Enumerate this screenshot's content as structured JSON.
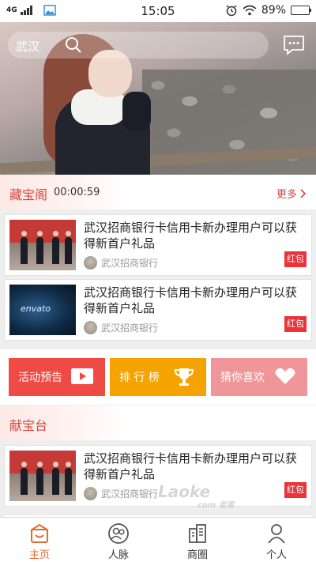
{
  "status_bar": {
    "network": "4G",
    "time": "15:05",
    "battery_percent": "89%",
    "battery_level": 0.89
  },
  "header": {
    "city": "武汉",
    "search_icon": "search-icon",
    "message_icon": "message-icon"
  },
  "treasure": {
    "title": "藏宝阁",
    "timer": "00:00:59",
    "more": "更多",
    "items": [
      {
        "title": "武汉招商银行卡信用卡新办理用户可以获得新首户礼品",
        "seller": "武汉招商银行",
        "tag": "红包",
        "thumb": "office"
      },
      {
        "title": "武汉招商银行卡信用卡新办理用户可以获得新首户礼品",
        "seller": "武汉招商银行",
        "tag": "红包",
        "thumb": "envato",
        "thumb_text": "envato"
      }
    ]
  },
  "actions": [
    {
      "label": "活动预告",
      "color": "#f04a44",
      "icon": "play-icon"
    },
    {
      "label": "排 行 榜",
      "color": "#f5a300",
      "icon": "trophy-icon"
    },
    {
      "label": "猜你喜欢",
      "color": "#f0969a",
      "icon": "heart-icon"
    }
  ],
  "offer": {
    "title": "献宝台",
    "items": [
      {
        "title": "武汉招商银行卡信用卡新办理用户可以获得新首户礼品",
        "seller": "武汉招商银行",
        "tag": "红包",
        "thumb": "office"
      }
    ]
  },
  "watermark": {
    "brand": "Laoke",
    "sub": "com 老客"
  },
  "bottom_nav": [
    {
      "label": "主页",
      "icon": "home-icon",
      "active": true
    },
    {
      "label": "人脉",
      "icon": "contacts-icon",
      "active": false
    },
    {
      "label": "商圈",
      "icon": "business-icon",
      "active": false
    },
    {
      "label": "个人",
      "icon": "person-icon",
      "active": false
    }
  ],
  "colors": {
    "accent": "#d4453f",
    "tag": "#e8343a",
    "nav_active": "#e36b2f"
  }
}
